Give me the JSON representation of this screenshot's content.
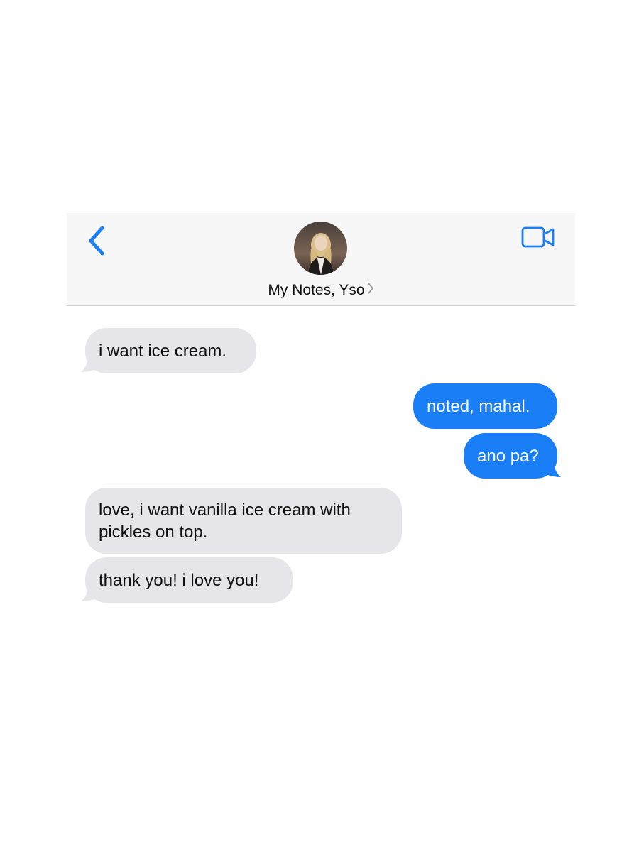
{
  "header": {
    "back_icon": "chevron-left-icon",
    "video_icon": "video-camera-icon",
    "contact_name": "My Notes, Yso",
    "contact_chevron_icon": "chevron-right-icon",
    "avatar_icon": "contact-photo"
  },
  "colors": {
    "accent": "#1a7ff7",
    "incoming_bubble": "#e5e5ea",
    "header_bg": "#f7f7f7"
  },
  "messages": [
    {
      "direction": "incoming",
      "text": "i want ice cream."
    },
    {
      "direction": "outgoing",
      "text": "noted, mahal."
    },
    {
      "direction": "outgoing",
      "text": "ano pa?"
    },
    {
      "direction": "incoming",
      "text": "love, i want vanilla ice cream with pickles on top."
    },
    {
      "direction": "incoming",
      "text": "thank you! i love you!"
    }
  ]
}
